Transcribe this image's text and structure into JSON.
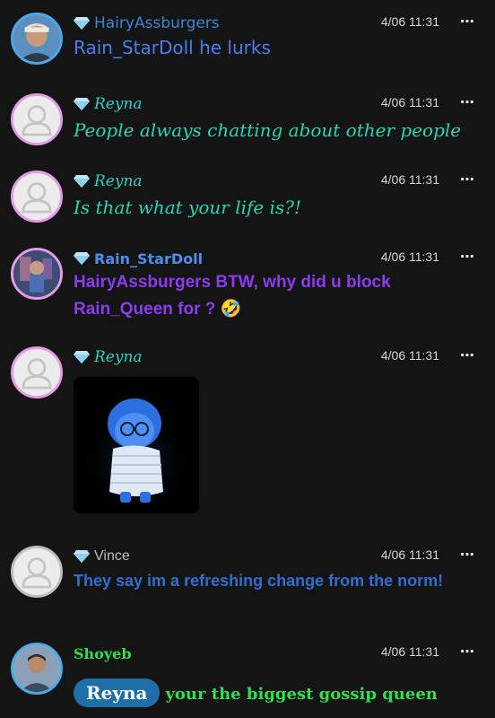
{
  "messages": [
    {
      "username": "HairyAssburgers",
      "time": "4/06 11:31",
      "text": "Rain_StarDoll he lurks",
      "name_color": "#3b86d6",
      "text_color": "#4a7ef0"
    },
    {
      "username": "Reyna",
      "time": "4/06 11:31",
      "text": "People always chatting about other people",
      "name_color": "#2fd0c4",
      "text_color": "#27d6b4"
    },
    {
      "username": "Reyna",
      "time": "4/06 11:31",
      "text": "Is that what your life is?!",
      "name_color": "#2fd0c4",
      "text_color": "#27d6b4"
    },
    {
      "username": "Rain_StarDoll",
      "time": "4/06 11:31",
      "text": "HairyAssburgers BTW, why did u block Rain_Queen for ? 🤣",
      "name_color": "#4b8ef0",
      "text_color": "#8a3cf0"
    },
    {
      "username": "Reyna",
      "time": "4/06 11:31",
      "image": "sadness-character-image",
      "name_color": "#2fd0c4"
    },
    {
      "username": "Vince",
      "time": "4/06 11:31",
      "text": "They say im a refreshing change from the norm!",
      "name_color": "#b9b9b9",
      "text_color": "#2f6fd0"
    },
    {
      "username": "Shoyeb",
      "time": "4/06 11:31",
      "mention": "Reyna",
      "text": "your the biggest gossip queen",
      "name_color": "#2fe04c",
      "text_color": "#2fe04c"
    }
  ],
  "more_icon": "⋯",
  "icons": {
    "diamond": "diamond-badge-icon",
    "more": "more-options-icon",
    "avatar_default": "default-avatar-icon"
  }
}
